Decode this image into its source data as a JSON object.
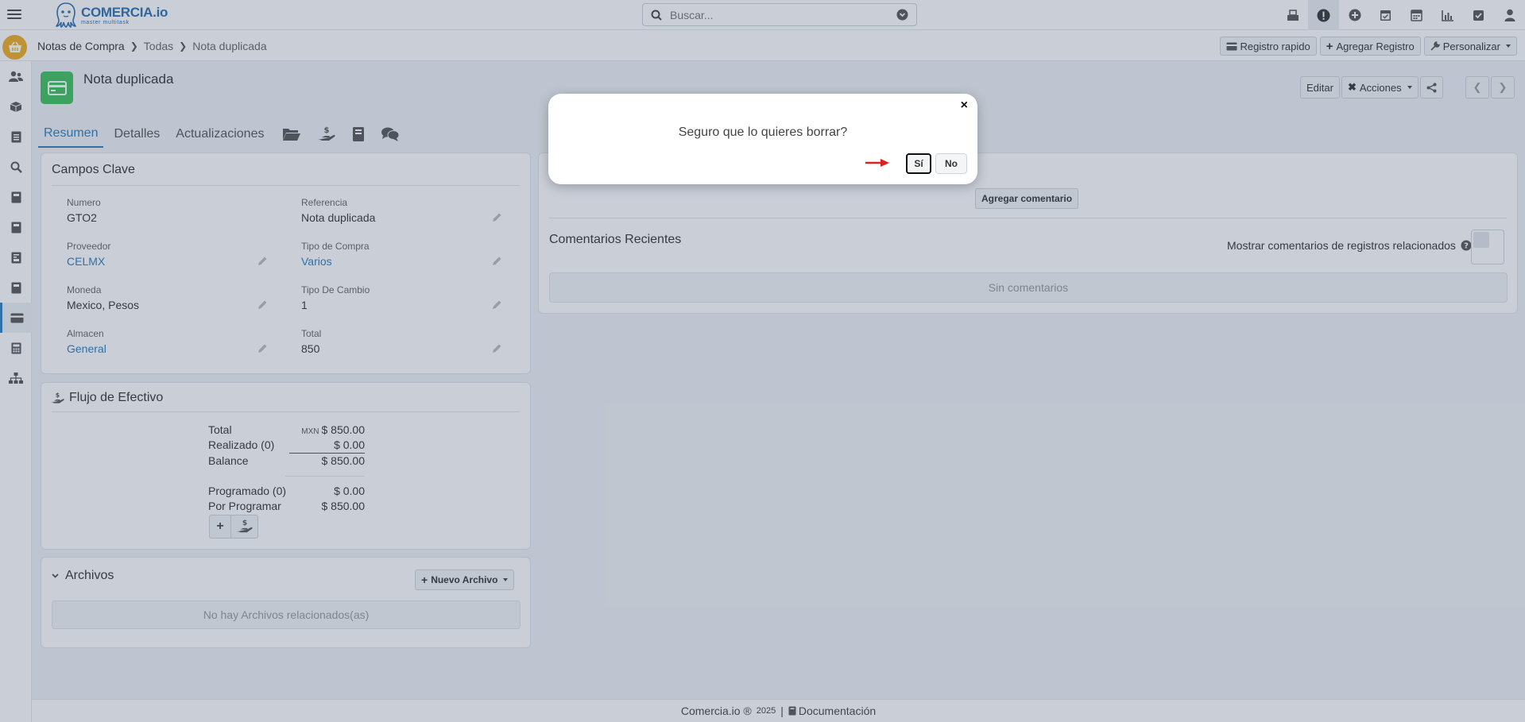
{
  "app": {
    "logo_title": "COMERCIA.io",
    "logo_subtitle": "master multitask"
  },
  "search": {
    "placeholder": "Buscar..."
  },
  "top_icons": [
    "inventory-icon",
    "alert-icon",
    "plus-circle-icon",
    "calendar-check-icon",
    "calendar-icon",
    "chart-icon",
    "checkbox-icon",
    "user-icon"
  ],
  "breadcrumb": {
    "items": [
      "Notas de Compra",
      "Todas",
      "Nota duplicada"
    ],
    "actions": {
      "quick": "Registro rapido",
      "add": "Agregar Registro",
      "customize": "Personalizar"
    }
  },
  "record": {
    "title": "Nota duplicada",
    "edit": "Editar",
    "actions": "Acciones"
  },
  "tabs": [
    "Resumen",
    "Detalles",
    "Actualizaciones"
  ],
  "key_fields": {
    "title": "Campos Clave",
    "numero_label": "Numero",
    "numero": "GTO2",
    "referencia_label": "Referencia",
    "referencia": "Nota duplicada",
    "proveedor_label": "Proveedor",
    "proveedor": "CELMX",
    "tipo_compra_label": "Tipo de Compra",
    "tipo_compra": "Varios",
    "moneda_label": "Moneda",
    "moneda": "Mexico, Pesos",
    "tipo_cambio_label": "Tipo De Cambio",
    "tipo_cambio": "1",
    "almacen_label": "Almacen",
    "almacen": "General",
    "total_label": "Total",
    "total": "850"
  },
  "cash_flow": {
    "title": "Flujo de Efectivo",
    "total_label": "Total",
    "currency": "MXN",
    "total": "$ 850.00",
    "realizado_label": "Realizado (0)",
    "realizado": "$ 0.00",
    "balance_label": "Balance",
    "balance": "$ 850.00",
    "programado_label": "Programado (0)",
    "programado": "$ 0.00",
    "por_programar_label": "Por Programar",
    "por_programar": "$ 850.00"
  },
  "files": {
    "title": "Archivos",
    "new_file": "Nuevo Archivo",
    "empty": "No hay Archivos relacionados(as)"
  },
  "comments": {
    "add": "Agregar comentario",
    "recent_title": "Comentarios Recientes",
    "show_related": "Mostrar comentarios de registros relacionados",
    "empty": "Sin comentarios"
  },
  "footer": {
    "brand": "Comercia.io ®",
    "year": "2025",
    "sep": "|",
    "docs": "Documentación"
  },
  "modal": {
    "message": "Seguro que lo quieres borrar?",
    "yes": "Sí",
    "no": "No",
    "close": "×"
  },
  "colors": {
    "accent": "#2a7fc0",
    "record_icon": "#3cc25a",
    "badge": "#f3ac20",
    "arrow": "#e02020"
  }
}
